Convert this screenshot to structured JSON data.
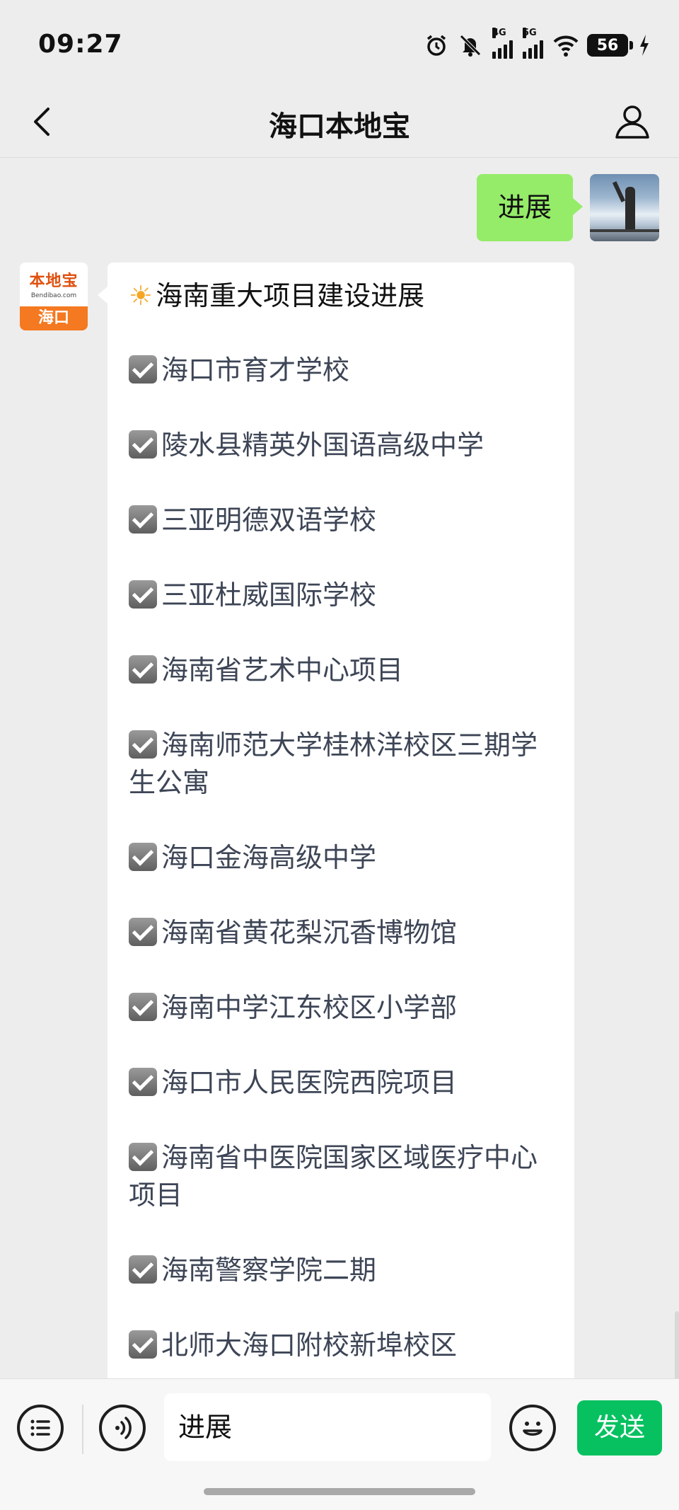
{
  "status_bar": {
    "time": "09:27",
    "network_1": "4G",
    "network_2": "5G",
    "battery": "56",
    "icons": [
      "alarm-icon",
      "mute-bell-icon",
      "signal-4g-icon",
      "signal-5g-icon",
      "wifi-icon",
      "battery-icon",
      "charging-icon"
    ]
  },
  "nav": {
    "title": "海口本地宝",
    "back_icon": "back-arrow-icon",
    "profile_icon": "person-icon"
  },
  "messages": {
    "sent": {
      "text": "进展"
    },
    "received": {
      "avatar": {
        "name": "本地宝",
        "url": "Bendibao.com",
        "city": "海口"
      },
      "title": "海南重大项目建设进展",
      "title_icon": "sun-icon",
      "items": [
        "海口市育才学校",
        "陵水县精英外国语高级中学",
        "三亚明德双语学校",
        "三亚杜威国际学校",
        "海南省艺术中心项目",
        "海南师范大学桂林洋校区三期学生公寓",
        "海口金海高级中学",
        "海南省黄花梨沉香博物馆",
        "海南中学江东校区小学部",
        "海口市人民医院西院项目",
        "海南省中医院国家区域医疗中心项目",
        "海南警察学院二期",
        "北师大海口附校新埠校区"
      ],
      "item_icon": "checkbox-checked-icon"
    }
  },
  "input_bar": {
    "input_value": "进展",
    "send_label": "发送",
    "icons": [
      "menu-list-icon",
      "voice-icon",
      "emoji-icon"
    ]
  },
  "colors": {
    "sent_bubble": "#95ec69",
    "send_button": "#07c160",
    "brand_orange": "#f47920"
  }
}
